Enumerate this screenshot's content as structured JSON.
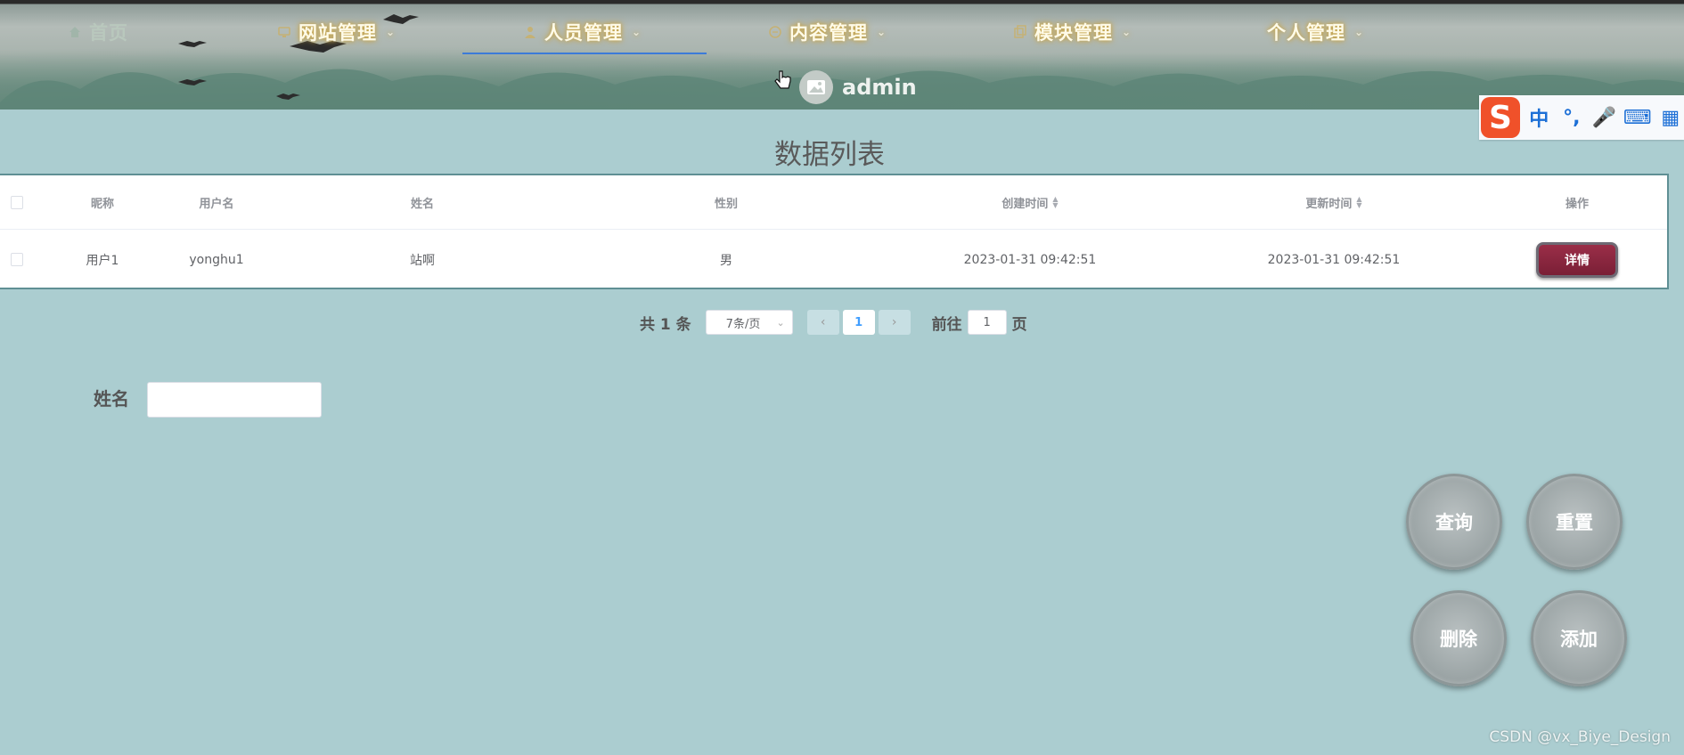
{
  "nav": {
    "items": [
      {
        "label": "首页",
        "icon": "home-icon"
      },
      {
        "label": "网站管理",
        "icon": "monitor-icon"
      },
      {
        "label": "人员管理",
        "icon": "user-icon"
      },
      {
        "label": "内容管理",
        "icon": "chat-icon"
      },
      {
        "label": "模块管理",
        "icon": "copy-icon"
      },
      {
        "label": "个人管理",
        "icon": ""
      }
    ],
    "active": "人员管理"
  },
  "user": {
    "name": "admin"
  },
  "ime": {
    "items": [
      "中",
      "°,",
      "🎤",
      "⌨",
      "▦"
    ]
  },
  "page": {
    "title": "数据列表"
  },
  "table": {
    "headers": [
      "昵称",
      "用户名",
      "姓名",
      "性别",
      "创建时间",
      "更新时间",
      "操作"
    ],
    "rows": [
      {
        "nickname": "用户1",
        "username": "yonghu1",
        "name": "站啊",
        "gender": "男",
        "created": "2023-01-31 09:42:51",
        "updated": "2023-01-31 09:42:51",
        "action": "详情"
      }
    ]
  },
  "pagination": {
    "total": "共 1 条",
    "page_size": "7条/页",
    "current_page": "1",
    "goto_label": "前往",
    "goto_value": "1",
    "goto_suffix": "页",
    "prev": "‹",
    "next": "›"
  },
  "search": {
    "name_label": "姓名",
    "name_value": ""
  },
  "actions": {
    "query": "查询",
    "reset": "重置",
    "delete": "删除",
    "add": "添加"
  },
  "watermark": "CSDN @vx_Biye_Design",
  "colors": {
    "background": "#abcdd0",
    "nav_underline": "#3c7bd8",
    "detail_button": "#8a2640",
    "ime_logo": "#f0512a"
  }
}
